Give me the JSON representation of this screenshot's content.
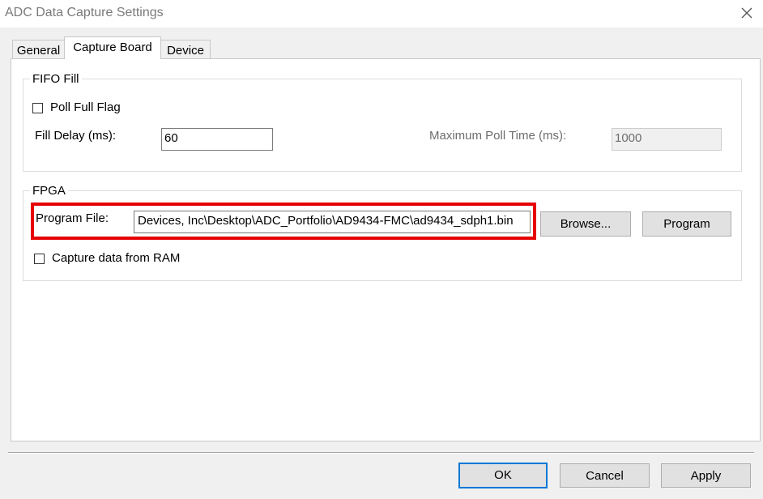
{
  "window": {
    "title": "ADC Data Capture Settings"
  },
  "tabs": [
    {
      "label": "General",
      "active": false
    },
    {
      "label": "Capture Board",
      "active": true
    },
    {
      "label": "Device",
      "active": false
    }
  ],
  "fifo_fill": {
    "group_label": "FIFO Fill",
    "poll_full_flag_label": "Poll Full Flag",
    "poll_full_flag_checked": false,
    "fill_delay_label": "Fill Delay (ms):",
    "fill_delay_value": "60",
    "max_poll_time_label": "Maximum Poll Time (ms):",
    "max_poll_time_value": "1000"
  },
  "fpga": {
    "group_label": "FPGA",
    "program_file_label": "Program File:",
    "program_file_value": "Devices, Inc\\Desktop\\ADC_Portfolio\\AD9434-FMC\\ad9434_sdph1.bin",
    "browse_label": "Browse...",
    "program_label": "Program",
    "capture_from_ram_label": "Capture data from RAM",
    "capture_from_ram_checked": false
  },
  "footer": {
    "ok_label": "OK",
    "cancel_label": "Cancel",
    "apply_label": "Apply"
  },
  "colors": {
    "highlight": "#e60000",
    "default_button_border": "#0078d7"
  },
  "icons": {
    "close": "close-icon"
  }
}
